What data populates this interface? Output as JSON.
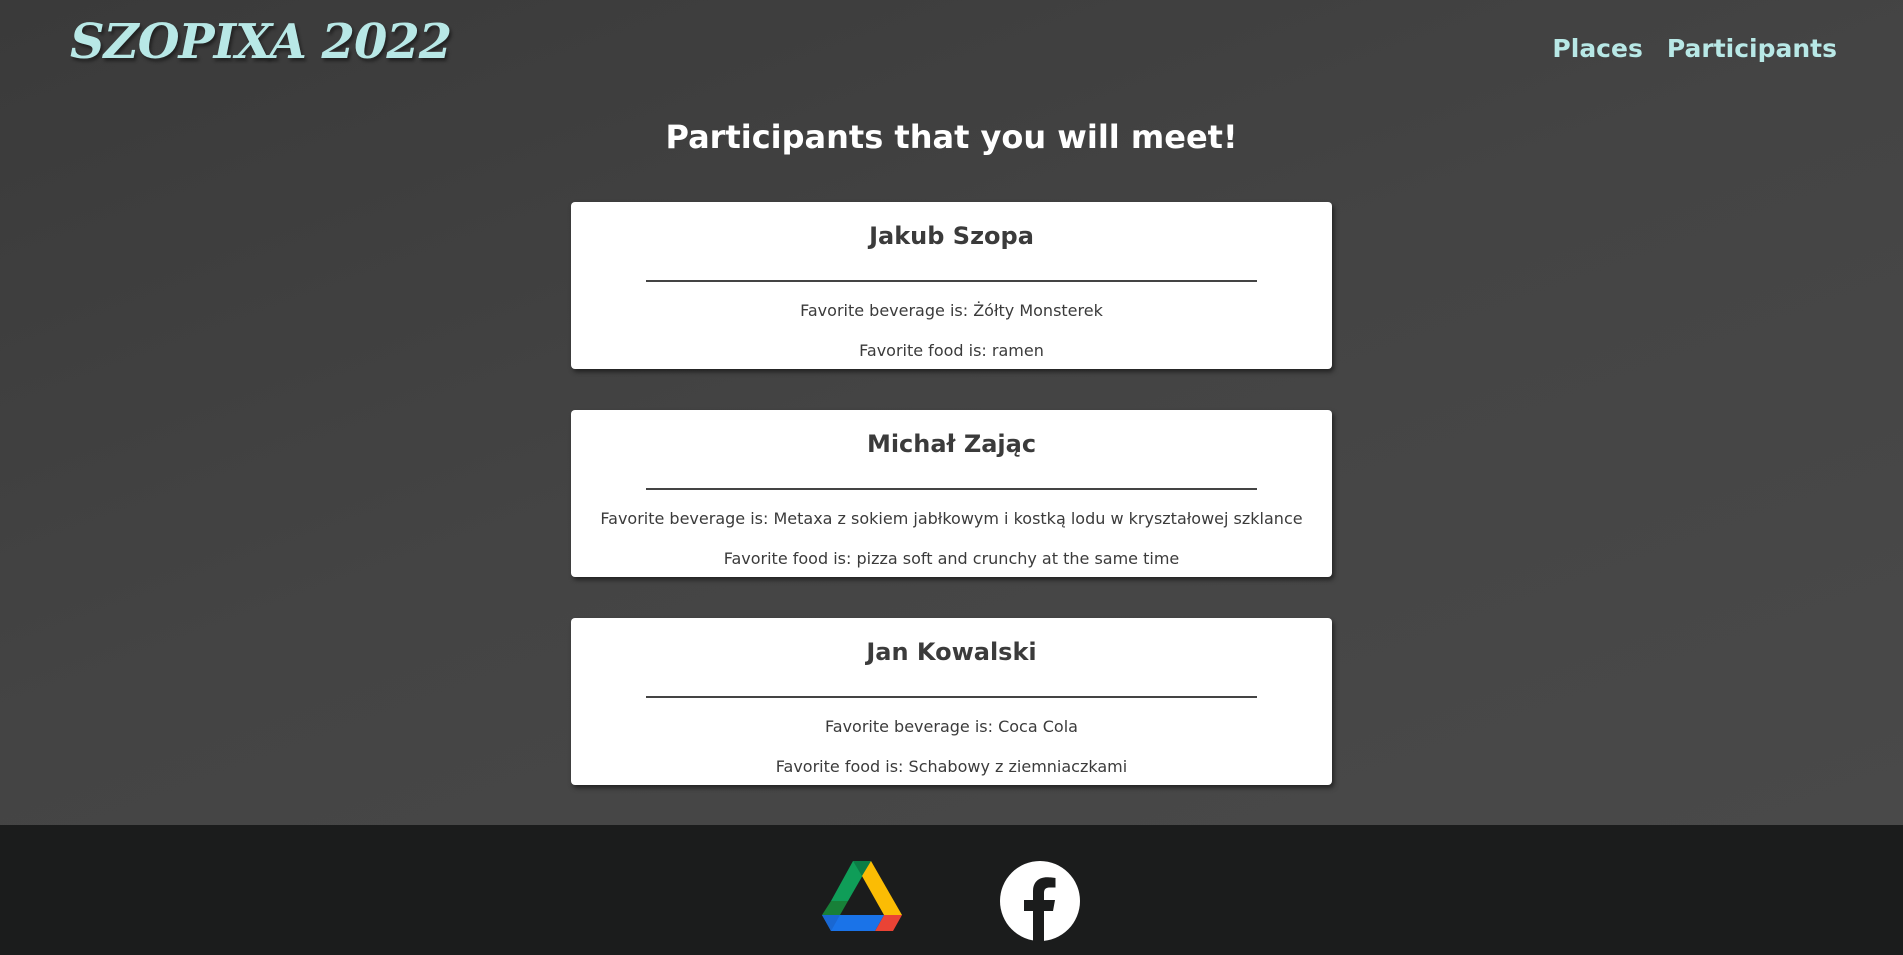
{
  "header": {
    "logo": "SZOPIXA 2022",
    "nav": [
      {
        "label": "Places"
      },
      {
        "label": "Participants"
      }
    ]
  },
  "main": {
    "title": "Participants that you will meet!",
    "participants": [
      {
        "name": "Jakub Szopa",
        "beverage": "Favorite beverage is: Żółty Monsterek",
        "food": "Favorite food is: ramen"
      },
      {
        "name": "Michał Zając",
        "beverage": "Favorite beverage is: Metaxa z sokiem jabłkowym i kostką lodu w kryształowej szklance",
        "food": "Favorite food is: pizza soft and crunchy at the same time"
      },
      {
        "name": "Jan Kowalski",
        "beverage": "Favorite beverage is: Coca Cola",
        "food": "Favorite food is: Schabowy z ziemniaczkami"
      }
    ]
  },
  "footer": {
    "icons": [
      "google-drive-icon",
      "facebook-icon"
    ]
  },
  "colors": {
    "accent": "#b8e8e6",
    "background": "#424242",
    "footer": "#1b1c1c",
    "card": "#ffffff"
  }
}
